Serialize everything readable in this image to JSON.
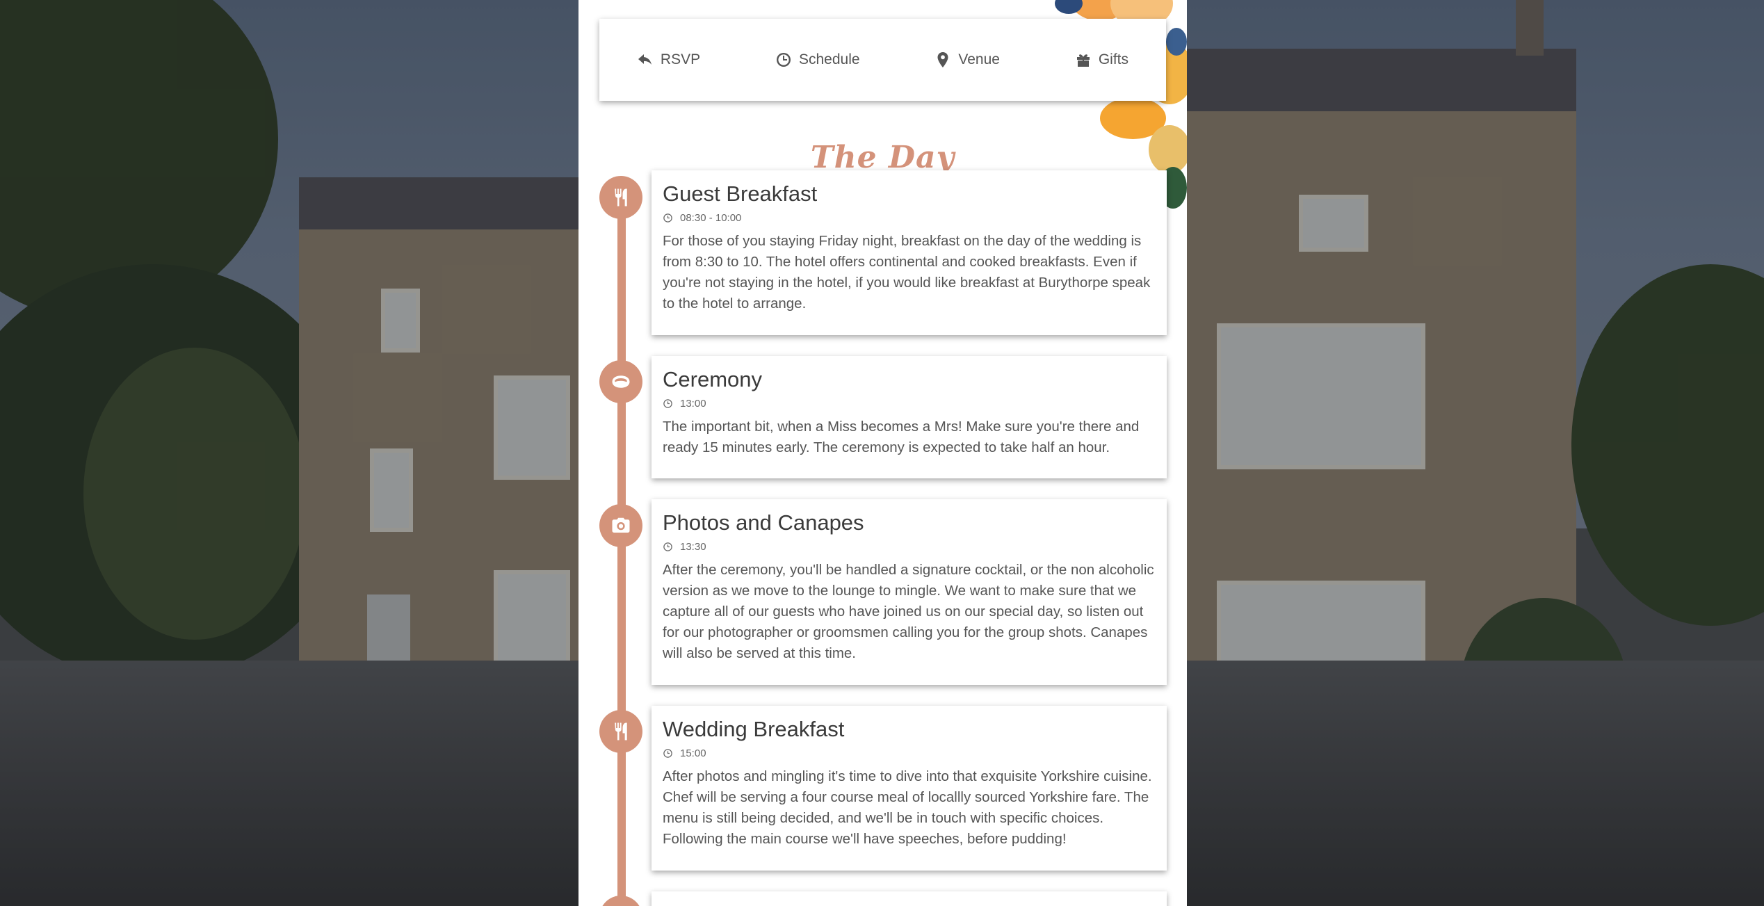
{
  "nav": {
    "items": [
      {
        "label": "RSVP",
        "icon": "reply-icon"
      },
      {
        "label": "Schedule",
        "icon": "clock-icon"
      },
      {
        "label": "Venue",
        "icon": "map-marker-icon"
      },
      {
        "label": "Gifts",
        "icon": "gift-icon"
      }
    ]
  },
  "page": {
    "title": "The Day"
  },
  "events": [
    {
      "title": "Guest Breakfast",
      "time": "08:30 - 10:00",
      "icon": "cutlery-icon",
      "description": "For those of you staying Friday night, breakfast on the day of the wedding is from 8:30 to 10. The hotel offers continental and cooked breakfasts. Even if you're not staying in the hotel, if you would like breakfast at Burythorpe speak to the hotel to arrange."
    },
    {
      "title": "Ceremony",
      "time": "13:00",
      "icon": "ring-icon",
      "description": "The important bit, when a Miss becomes a Mrs! Make sure you're there and ready 15 minutes early. The ceremony is expected to take half an hour."
    },
    {
      "title": "Photos and Canapes",
      "time": "13:30",
      "icon": "camera-icon",
      "description": "After the ceremony, you'll be handled a signature cocktail, or the non alcoholic version as we move to the lounge to mingle. We want to make sure that we capture all of our guests who have joined us on our special day, so listen out for our photographer or groomsmen calling you for the group shots. Canapes will also be served at this time."
    },
    {
      "title": "Wedding Breakfast",
      "time": "15:00",
      "icon": "cutlery-icon",
      "description": "After photos and mingling it's time to dive into that exquisite Yorkshire cuisine. Chef will be serving a four course meal of locallly sourced Yorkshire fare. The menu is still being decided, and we'll be in touch with specific choices. Following the main course we'll have speeches, before pudding!"
    }
  ],
  "colors": {
    "accent": "#d4937a",
    "text": "#555555",
    "heading": "#3a3a3a"
  }
}
